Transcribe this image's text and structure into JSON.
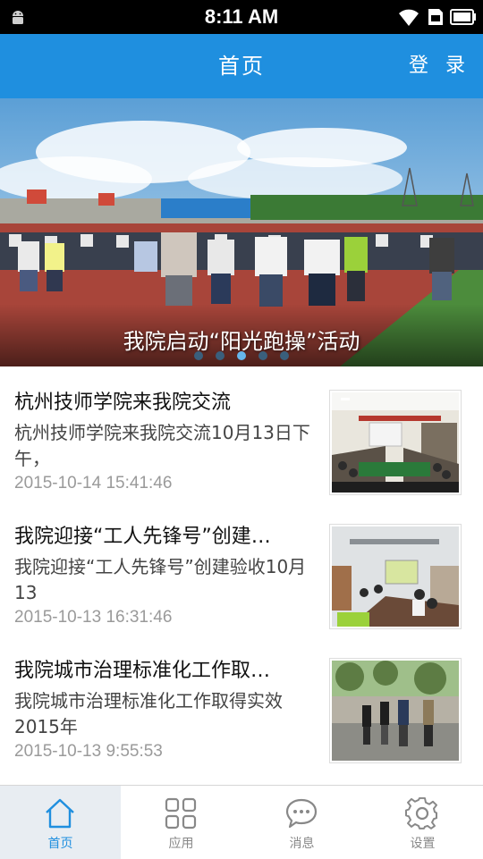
{
  "status_bar": {
    "time": "8:11 AM",
    "icons": [
      "android-icon",
      "wifi-icon",
      "sim-icon",
      "battery-icon"
    ]
  },
  "header": {
    "title": "首页",
    "login_label": "登 录",
    "background_color": "#1f8fdf"
  },
  "banner": {
    "caption": "我院启动“阳光跑操”活动",
    "dots_total": 5,
    "active_dot": 3
  },
  "news": [
    {
      "title": "杭州技师学院来我院交流",
      "summary": "杭州技师学院来我院交流10月13日下午，",
      "time": "2015-10-14 15:41:46"
    },
    {
      "title": "我院迎接“工人先锋号”创建…",
      "summary": "我院迎接“工人先锋号”创建验收10月13",
      "time": "2015-10-13 16:31:46"
    },
    {
      "title": "我院城市治理标准化工作取…",
      "summary": "我院城市治理标准化工作取得实效2015年",
      "time": "2015-10-13 9:55:53"
    }
  ],
  "bottom_nav": {
    "active_color": "#1f8fdf",
    "tabs": [
      {
        "label": "首页",
        "icon": "home-icon",
        "active": true
      },
      {
        "label": "应用",
        "icon": "apps-grid-icon",
        "active": false
      },
      {
        "label": "消息",
        "icon": "message-icon",
        "active": false
      },
      {
        "label": "设置",
        "icon": "gear-icon",
        "active": false
      }
    ]
  }
}
